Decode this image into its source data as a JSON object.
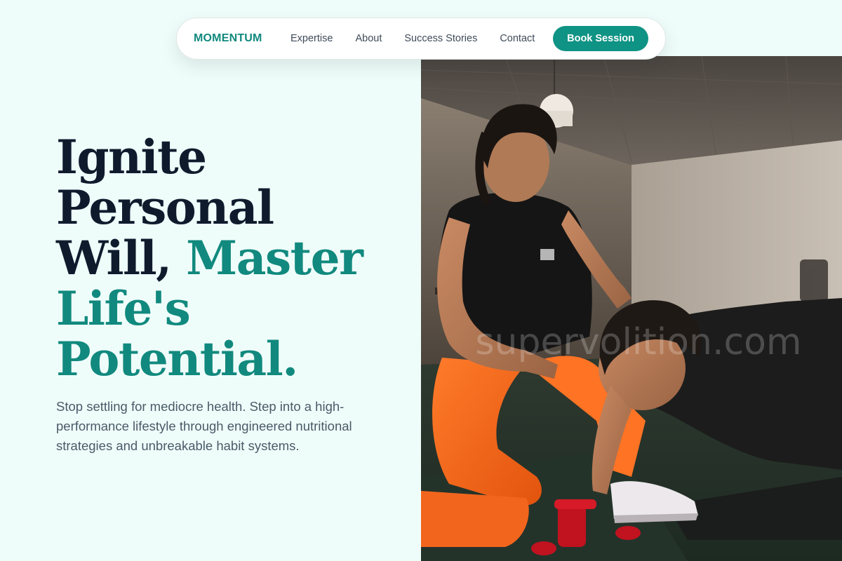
{
  "nav": {
    "brand": "MOMENTUM",
    "links": [
      "Expertise",
      "About",
      "Success Stories",
      "Contact"
    ],
    "cta": "Book Session"
  },
  "hero": {
    "headline_dark_1": "Ignite",
    "headline_dark_2": "Personal",
    "headline_dark_3": "Will,",
    "headline_accent_1": "Master",
    "headline_accent_2": "Life's",
    "headline_accent_3": "Potential.",
    "subtitle": "Stop settling for mediocre health. Step into a high-performance lifestyle through engineered nutritional strategies and unbreakable habit systems.",
    "image_watermark": "supervolition.com"
  },
  "colors": {
    "accent": "#11897e",
    "button": "#0f9384",
    "heading": "#0f1b2d",
    "background": "#effdfa"
  }
}
